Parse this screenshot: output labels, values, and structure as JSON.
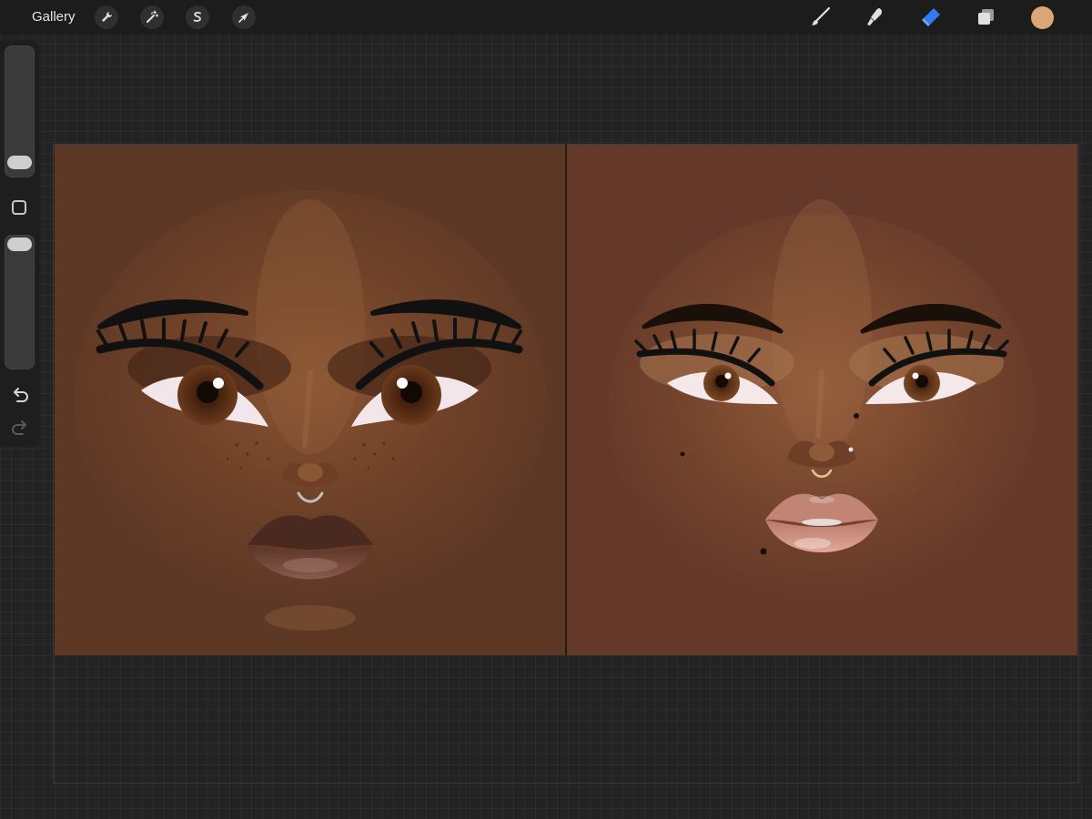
{
  "app": {
    "gallery_label": "Gallery"
  },
  "toolbar": {
    "left_tools": [
      {
        "name": "actions",
        "icon": "wrench-icon"
      },
      {
        "name": "adjustments",
        "icon": "magic-wand-icon"
      },
      {
        "name": "selection",
        "icon": "selection-s-icon"
      },
      {
        "name": "transform",
        "icon": "arrow-cursor-icon"
      }
    ],
    "right_tools": [
      {
        "name": "brush",
        "icon": "brush-icon",
        "active": false
      },
      {
        "name": "smudge",
        "icon": "smudge-icon",
        "active": false
      },
      {
        "name": "eraser",
        "icon": "eraser-icon",
        "active": true
      },
      {
        "name": "layers",
        "icon": "layers-icon",
        "active": false
      }
    ],
    "current_color": "#dba676",
    "active_color": "#2f7cf6"
  },
  "sidebar": {
    "brush_size": 0.05,
    "opacity": 1.0,
    "undo_icon": "undo-icon",
    "redo_icon": "redo-icon",
    "modify_icon": "square-modify-icon"
  },
  "canvas": {
    "left_bg": "#5d3825",
    "right_bg": "#64392a"
  }
}
